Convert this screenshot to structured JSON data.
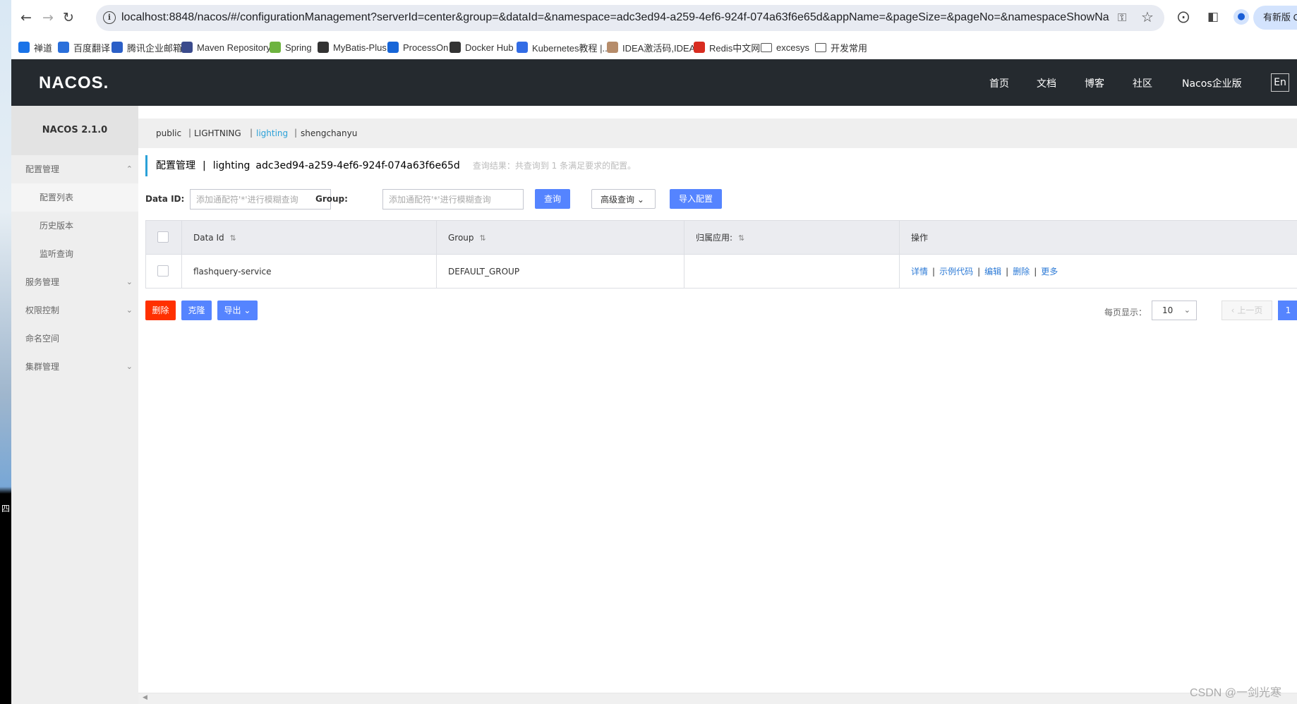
{
  "browser": {
    "url": "localhost:8848/nacos/#/configurationManagement?serverId=center&group=&dataId=&namespace=adc3ed94-a259-4ef6-924f-074a63f6e65d&appName=&pageSize=&pageNo=&namespaceShowName=...",
    "new_version_label": "有新版 Ch",
    "bookmarks": [
      {
        "label": "禅道",
        "icon": "zentao-icon",
        "color": "#1a73e8"
      },
      {
        "label": "百度翻译",
        "icon": "baidu-translate-icon",
        "color": "#2a6fdb"
      },
      {
        "label": "腾讯企业邮箱",
        "icon": "tencent-mail-icon",
        "color": "#2b5fc7"
      },
      {
        "label": "Maven Repository",
        "icon": "maven-icon",
        "color": "#3b4b8c"
      },
      {
        "label": "Spring",
        "icon": "spring-icon",
        "color": "#6db33f"
      },
      {
        "label": "MyBatis-Plus",
        "icon": "mybatis-icon",
        "color": "#333333"
      },
      {
        "label": "ProcessOn",
        "icon": "processon-icon",
        "color": "#1665d8"
      },
      {
        "label": "Docker Hub",
        "icon": "docker-icon",
        "color": "#333333"
      },
      {
        "label": "Kubernetes教程 |...",
        "icon": "kubernetes-icon",
        "color": "#326ce5"
      },
      {
        "label": "IDEA激活码,IDEA...",
        "icon": "idea-icon",
        "color": "#b68c6a"
      },
      {
        "label": "Redis中文网",
        "icon": "redis-icon",
        "color": "#d82c20"
      },
      {
        "label": "excesys",
        "icon": "folder-icon",
        "color": "#555555"
      },
      {
        "label": "开发常用",
        "icon": "folder-icon",
        "color": "#555555"
      }
    ]
  },
  "header": {
    "logo": "NACOS.",
    "nav": [
      "首页",
      "文档",
      "博客",
      "社区",
      "Nacos企业版"
    ],
    "lang": "En"
  },
  "sidebar": {
    "version": "NACOS 2.1.0",
    "items": [
      {
        "label": "配置管理",
        "level": 1,
        "chevron": "^"
      },
      {
        "label": "配置列表",
        "level": 2,
        "active": true
      },
      {
        "label": "历史版本",
        "level": 2
      },
      {
        "label": "监听查询",
        "level": 2
      },
      {
        "label": "服务管理",
        "level": 1,
        "chevron": "v"
      },
      {
        "label": "权限控制",
        "level": 1,
        "chevron": "v"
      },
      {
        "label": "命名空间",
        "level": 1
      },
      {
        "label": "集群管理",
        "level": 1,
        "chevron": "v"
      }
    ]
  },
  "namespaces": [
    {
      "label": "public"
    },
    {
      "label": "LIGHTNING"
    },
    {
      "label": "lighting",
      "current": true
    },
    {
      "label": "shengchanyu"
    }
  ],
  "page": {
    "title": "配置管理",
    "separator": "|",
    "namespace_name": "lighting",
    "namespace_id": "adc3ed94-a259-4ef6-924f-074a63f6e65d",
    "result_hint": "查询结果：共查询到 1 条满足要求的配置。"
  },
  "search": {
    "dataid_label": "Data ID:",
    "dataid_placeholder": "添加通配符'*'进行模糊查询",
    "group_label": "Group:",
    "group_placeholder": "添加通配符'*'进行模糊查询",
    "query_button": "查询",
    "advanced_button": "高级查询",
    "import_button": "导入配置"
  },
  "table": {
    "columns": [
      "Data Id",
      "Group",
      "归属应用:",
      "操作"
    ],
    "rows": [
      {
        "data_id": "flashquery-service",
        "group": "DEFAULT_GROUP",
        "app": "",
        "ops": [
          "详情",
          "示例代码",
          "编辑",
          "删除",
          "更多"
        ]
      }
    ]
  },
  "footer": {
    "delete_button": "删除",
    "clone_button": "克隆",
    "export_button": "导出",
    "page_size_label": "每页显示：",
    "page_size": "10",
    "prev_label": "上一页",
    "current_page": "1"
  },
  "watermark": "CSDN @一剑光寒",
  "desktop_char": "四"
}
